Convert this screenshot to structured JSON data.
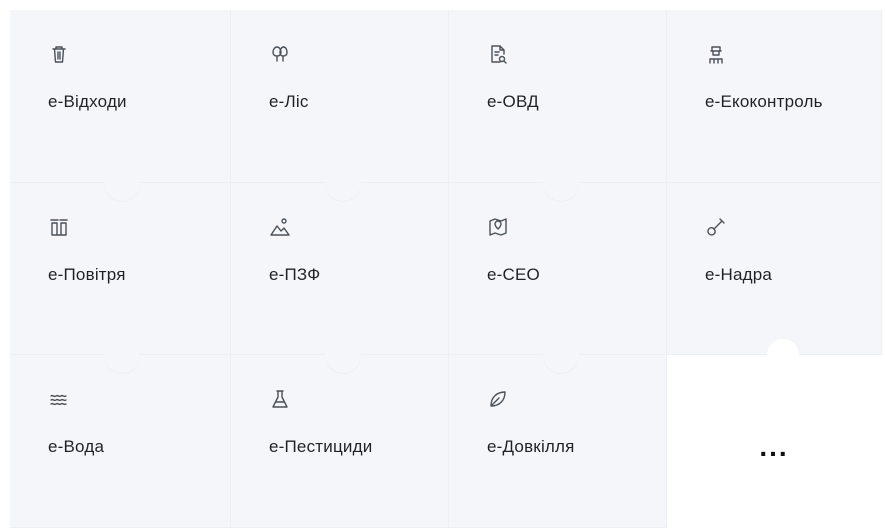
{
  "tiles": [
    {
      "label": "e-Відходи",
      "icon": "trash-icon"
    },
    {
      "label": "e-Ліс",
      "icon": "tree-icon"
    },
    {
      "label": "e-ОВД",
      "icon": "document-search-icon"
    },
    {
      "label": "e-Екоконтроль",
      "icon": "inspector-icon"
    },
    {
      "label": "e-Повітря",
      "icon": "factory-chimney-icon"
    },
    {
      "label": "e-ПЗФ",
      "icon": "mountain-icon"
    },
    {
      "label": "e-СЕО",
      "icon": "map-pin-icon"
    },
    {
      "label": "e-Надра",
      "icon": "shovel-icon"
    },
    {
      "label": "e-Вода",
      "icon": "water-waves-icon"
    },
    {
      "label": "e-Пестициди",
      "icon": "flask-icon"
    },
    {
      "label": "e-Довкілля",
      "icon": "leaf-icon"
    }
  ],
  "more": {
    "label": "..."
  }
}
